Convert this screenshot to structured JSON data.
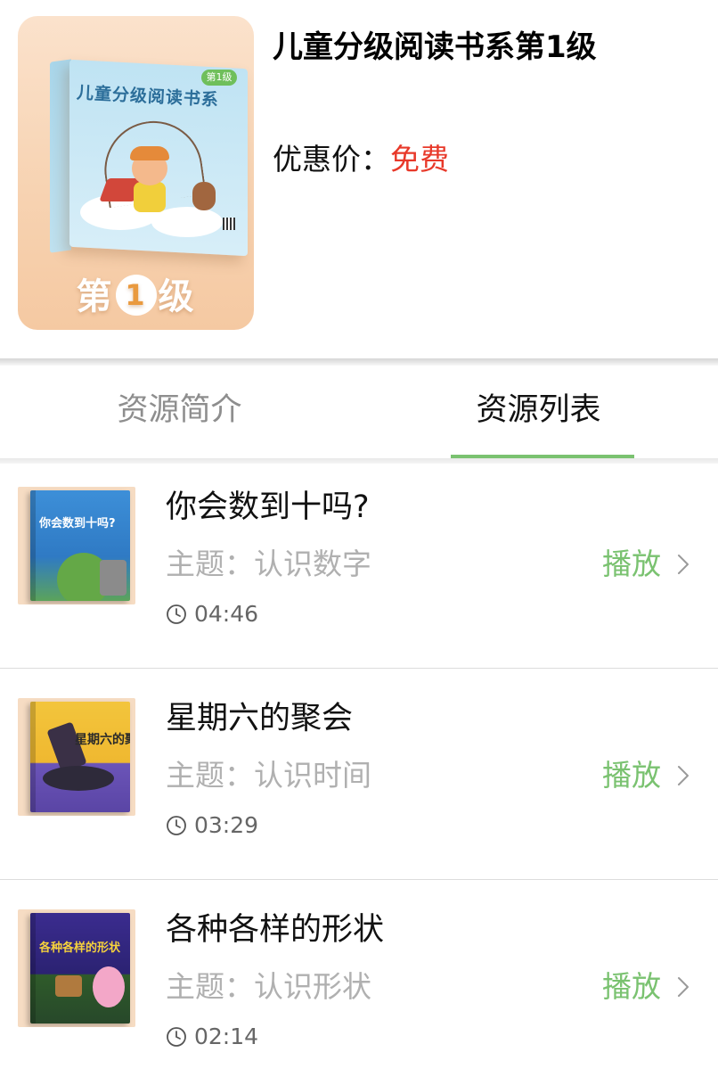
{
  "product": {
    "cover_series_title": "儿童分级阅读书系",
    "cover_badge": "第1级",
    "cover_level_prefix": "第",
    "cover_level_number": "1",
    "cover_level_suffix": "级",
    "title": "儿童分级阅读书系第1级",
    "price_label": "优惠价：",
    "price_value": "免费"
  },
  "tabs": [
    {
      "label": "资源简介",
      "active": false
    },
    {
      "label": "资源列表",
      "active": true
    }
  ],
  "resources": [
    {
      "thumb_title": "你会数到十吗?",
      "title": "你会数到十吗?",
      "subject": "主题：认识数字",
      "duration": "04:46",
      "action": "播放"
    },
    {
      "thumb_title": "星期六的聚会",
      "title": "星期六的聚会",
      "subject": "主题：认识时间",
      "duration": "03:29",
      "action": "播放"
    },
    {
      "thumb_title": "各种各样的形状",
      "title": "各种各样的形状",
      "subject": "主题：认识形状",
      "duration": "02:14",
      "action": "播放"
    }
  ],
  "icons": {
    "duration": "clock-icon",
    "navigate": "chevron-right-icon"
  },
  "colors": {
    "accent_green": "#7ac270",
    "price_red": "#e8392a",
    "muted_text": "#b0b0b0"
  }
}
